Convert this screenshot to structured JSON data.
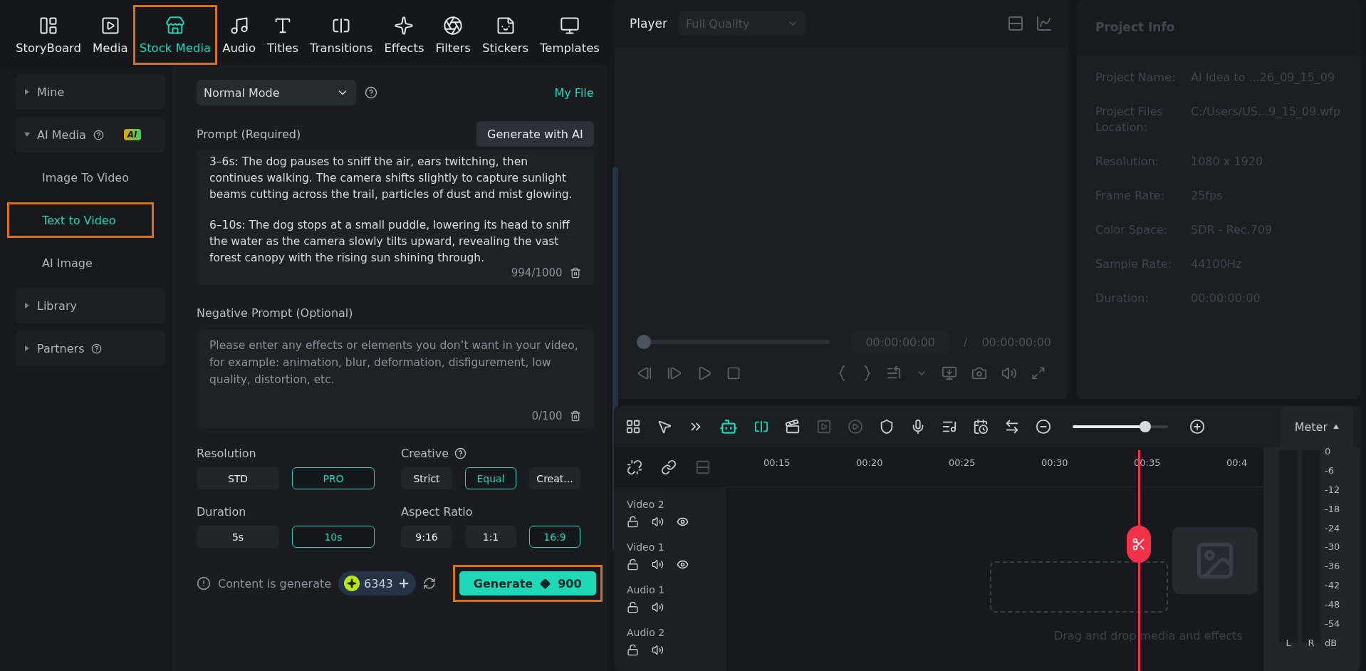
{
  "nav_tabs": [
    {
      "label": "StoryBoard",
      "selected": false,
      "highlighted": false
    },
    {
      "label": "Media",
      "selected": false,
      "highlighted": false
    },
    {
      "label": "Stock Media",
      "selected": true,
      "highlighted": true
    },
    {
      "label": "Audio",
      "selected": false,
      "highlighted": false
    },
    {
      "label": "Titles",
      "selected": false,
      "highlighted": false
    },
    {
      "label": "Transitions",
      "selected": false,
      "highlighted": false
    },
    {
      "label": "Effects",
      "selected": false,
      "highlighted": false
    },
    {
      "label": "Filters",
      "selected": false,
      "highlighted": false
    },
    {
      "label": "Stickers",
      "selected": false,
      "highlighted": false
    },
    {
      "label": "Templates",
      "selected": false,
      "highlighted": false
    }
  ],
  "sidebar": {
    "items": [
      {
        "kind": "group",
        "label": "Mine",
        "expanded": false,
        "help": false
      },
      {
        "kind": "group",
        "label": "AI Media",
        "expanded": true,
        "help": true,
        "badge": "AI"
      },
      {
        "kind": "sub",
        "label": "Image To Video",
        "selected": false,
        "highlighted": false
      },
      {
        "kind": "sub",
        "label": "Text to Video",
        "selected": true,
        "highlighted": true
      },
      {
        "kind": "sub",
        "label": "AI Image",
        "selected": false,
        "highlighted": false
      },
      {
        "kind": "group",
        "label": "Library",
        "expanded": false,
        "help": false
      },
      {
        "kind": "group",
        "label": "Partners",
        "expanded": false,
        "help": true
      }
    ]
  },
  "generator": {
    "mode": "Normal Mode",
    "my_file": "My File",
    "prompt_label": "Prompt (Required)",
    "generate_with_ai": "Generate with AI",
    "prompt_paragraphs": [
      "3–6s: The dog pauses to sniff the air, ears twitching, then continues walking. The camera shifts slightly to capture sunlight beams cutting across the trail, particles of dust and mist glowing.",
      "6–10s: The dog stops at a small puddle, lowering its head to sniff the water as the camera slowly tilts upward, revealing the vast forest canopy with the rising sun shining through."
    ],
    "prompt_count": "994/1000",
    "negative_label": "Negative Prompt (Optional)",
    "negative_placeholder": "Please enter any effects or elements you don’t want in your video, for example: animation, blur, deformation, disfigurement, low quality, distortion, etc.",
    "negative_count": "0/100",
    "option_groups": [
      {
        "label": "Resolution",
        "help": false,
        "options": [
          {
            "label": "STD",
            "selected": false
          },
          {
            "label": "PRO",
            "selected": true
          }
        ]
      },
      {
        "label": "Creative",
        "help": true,
        "options": [
          {
            "label": "Strict",
            "selected": false
          },
          {
            "label": "Equal",
            "selected": true
          },
          {
            "label": "Creat...",
            "selected": false
          }
        ]
      },
      {
        "label": "Duration",
        "help": false,
        "options": [
          {
            "label": "5s",
            "selected": false
          },
          {
            "label": "10s",
            "selected": true
          }
        ]
      },
      {
        "label": "Aspect Ratio",
        "help": false,
        "options": [
          {
            "label": "9:16",
            "selected": false
          },
          {
            "label": "1:1",
            "selected": false
          },
          {
            "label": "16:9",
            "selected": true
          }
        ]
      }
    ],
    "notice": "Content is generate",
    "credits": "6343",
    "generate": {
      "label": "Generate",
      "cost": "900",
      "highlighted": true
    }
  },
  "player": {
    "title": "Player",
    "quality": "Full Quality",
    "level": 0,
    "current_time": "00:00:00:00",
    "separator": "/",
    "total_time": "00:00:00:00"
  },
  "project_info": {
    "title": "Project Info",
    "rows": [
      {
        "label": "Project Name:",
        "value": "AI Idea to ...26_09_15_09"
      },
      {
        "label": "Project Files Location:",
        "value": "C:/Users/US...9_15_09.wfp"
      },
      {
        "label": "Resolution:",
        "value": "1080 x 1920"
      },
      {
        "label": "Frame Rate:",
        "value": "25fps"
      },
      {
        "label": "Color Space:",
        "value": "SDR - Rec.709"
      },
      {
        "label": "Sample Rate:",
        "value": "44100Hz"
      },
      {
        "label": "Duration:",
        "value": "00:00:00:00"
      }
    ]
  },
  "timeline": {
    "zoom": {
      "level": 0.76
    },
    "meter_button": "Meter",
    "ruler": [
      "00:15",
      "00:20",
      "00:25",
      "00:30",
      "00:35",
      "00:4"
    ],
    "tracks": [
      {
        "name": "Video 2",
        "kind": "video"
      },
      {
        "name": "Video 1",
        "kind": "video"
      },
      {
        "name": "Audio 1",
        "kind": "audio"
      },
      {
        "name": "Audio 2",
        "kind": "audio"
      }
    ],
    "drop_hint": "Drag and drop media and effects",
    "meter_scale": [
      "0",
      "-6",
      "-12",
      "-18",
      "-24",
      "-30",
      "-36",
      "-42",
      "-48",
      "-54",
      "dB"
    ],
    "meter_channels": [
      "L",
      "R"
    ]
  }
}
